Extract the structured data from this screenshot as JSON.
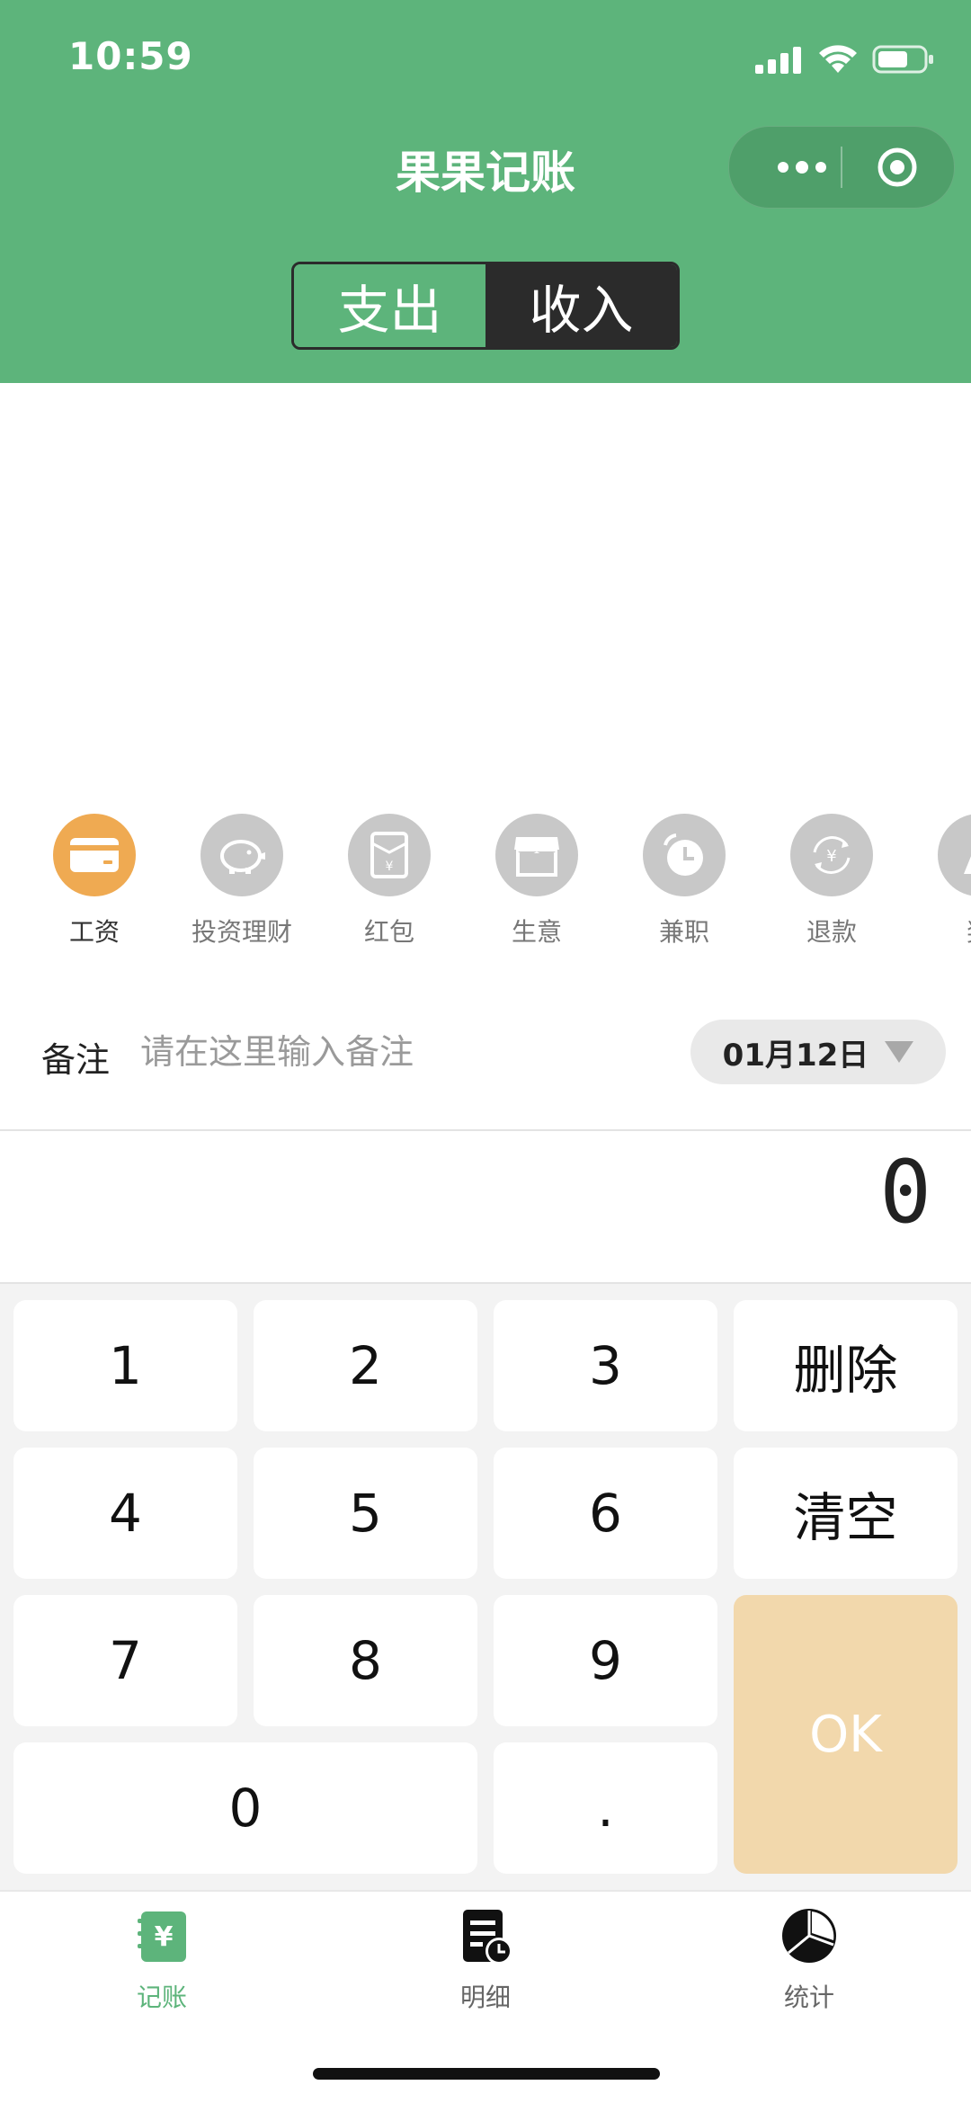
{
  "status_bar": {
    "time": "10:59"
  },
  "header": {
    "title": "果果记账",
    "tabs": [
      {
        "label": "支出",
        "active": false
      },
      {
        "label": "收入",
        "active": true
      }
    ],
    "colors": {
      "brand": "#5db47b",
      "tab_active": "#2b2b2b"
    }
  },
  "categories": [
    {
      "label": "工资",
      "icon": "card-icon",
      "active": true
    },
    {
      "label": "投资理财",
      "icon": "piggy-bank-icon",
      "active": false
    },
    {
      "label": "红包",
      "icon": "red-envelope-icon",
      "active": false
    },
    {
      "label": "生意",
      "icon": "shop-icon",
      "active": false
    },
    {
      "label": "兼职",
      "icon": "clock-icon",
      "active": false
    },
    {
      "label": "退款",
      "icon": "refund-icon",
      "active": false
    },
    {
      "label": "奖",
      "icon": "reward-icon",
      "active": false
    }
  ],
  "remark": {
    "label": "备注",
    "placeholder": "请在这里输入备注",
    "value": ""
  },
  "date": {
    "label": "01月12日"
  },
  "amount": {
    "value": "0"
  },
  "keypad": {
    "k1": "1",
    "k2": "2",
    "k3": "3",
    "k4": "4",
    "k5": "5",
    "k6": "6",
    "k7": "7",
    "k8": "8",
    "k9": "9",
    "k0": "0",
    "dot": ".",
    "delete": "删除",
    "clear": "清空",
    "ok": "OK",
    "ok_color": "#f2d8ac"
  },
  "tabbar": {
    "items": [
      {
        "label": "记账",
        "icon": "ledger-icon",
        "active": true
      },
      {
        "label": "明细",
        "icon": "details-icon",
        "active": false
      },
      {
        "label": "统计",
        "icon": "pie-chart-icon",
        "active": false
      }
    ]
  }
}
